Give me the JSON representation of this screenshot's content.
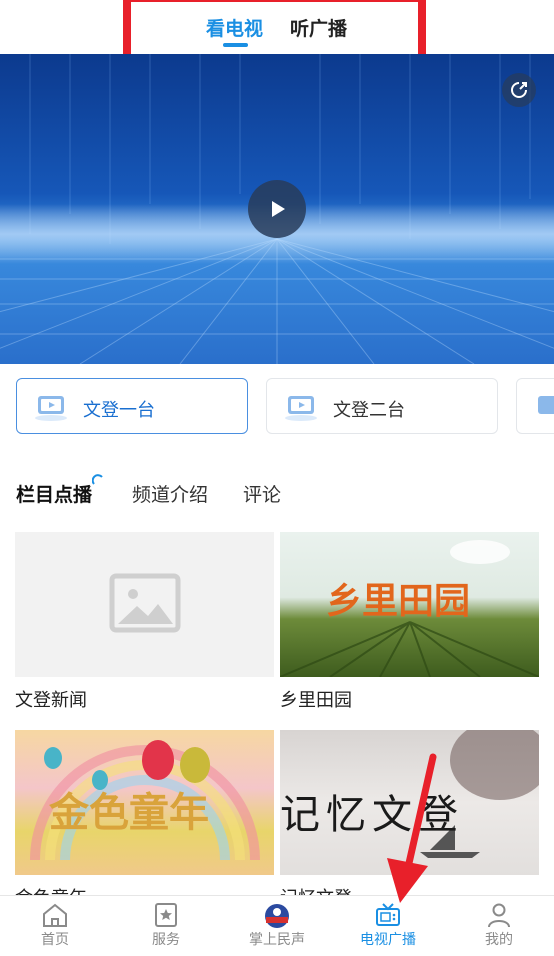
{
  "top_tabs": [
    {
      "label": "看电视",
      "active": true
    },
    {
      "label": "听广播",
      "active": false
    }
  ],
  "channels": [
    {
      "label": "文登一台",
      "active": true
    },
    {
      "label": "文登二台",
      "active": false
    }
  ],
  "sub_tabs": [
    {
      "label": "栏目点播",
      "active": true
    },
    {
      "label": "频道介绍",
      "active": false
    },
    {
      "label": "评论",
      "active": false
    }
  ],
  "programs": [
    {
      "title": "文登新闻",
      "thumb_text": ""
    },
    {
      "title": "乡里田园",
      "thumb_text": "乡里田园"
    },
    {
      "title": "金色童年",
      "thumb_text": "金色童年"
    },
    {
      "title": "记忆文登",
      "thumb_text": "记忆文登"
    }
  ],
  "bottom_nav": [
    {
      "label": "首页",
      "icon": "home-icon",
      "active": false
    },
    {
      "label": "服务",
      "icon": "bookmark-star-icon",
      "active": false
    },
    {
      "label": "掌上民声",
      "icon": "minsheng-logo-icon",
      "active": false
    },
    {
      "label": "电视广播",
      "icon": "tv-icon",
      "active": true
    },
    {
      "label": "我的",
      "icon": "user-icon",
      "active": false
    }
  ],
  "colors": {
    "accent": "#1a8fe3",
    "highlight_box": "#e8202a",
    "annotation_arrow": "#e8202a"
  }
}
